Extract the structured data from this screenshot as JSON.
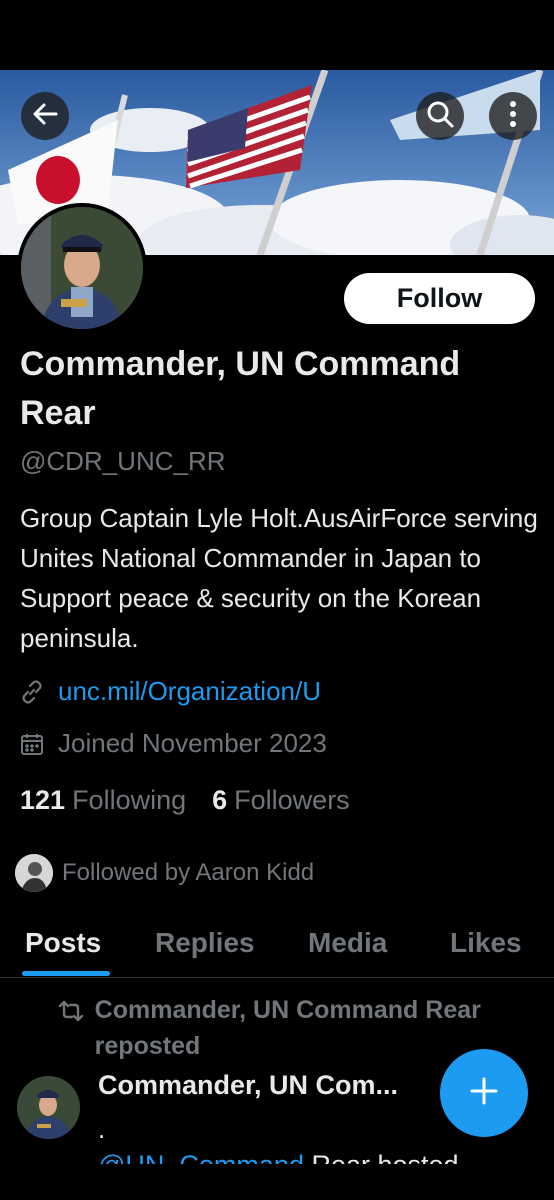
{
  "profile": {
    "name": "Commander, UN Command Rear",
    "handle": "@CDR_UNC_RR",
    "bio": "Group Captain Lyle Holt.AusAirForce serving Unites National Commander in Japan to Support peace & security on the Korean peninsula.",
    "link": "unc.mil/Organization/U",
    "joined": "Joined November 2023",
    "following_count": "121",
    "following_label": "Following",
    "followers_count": "6",
    "followers_label": "Followers",
    "followed_by": "Followed by Aaron Kidd"
  },
  "actions": {
    "follow_label": "Follow",
    "back_icon": "arrow-left-icon",
    "search_icon": "search-icon",
    "more_icon": "more-vertical-icon",
    "compose_icon": "plus-icon"
  },
  "tabs": [
    {
      "label": "Posts",
      "active": true
    },
    {
      "label": "Replies",
      "active": false
    },
    {
      "label": "Media",
      "active": false
    },
    {
      "label": "Likes",
      "active": false
    }
  ],
  "post": {
    "repost_label": "Commander, UN Command Rear reposted",
    "author": "Commander, UN Com...",
    "dot": ".",
    "text_mention": "@UN_Command",
    "text_rest": " Rear hosted"
  },
  "colors": {
    "accent": "#1d9bf0",
    "background": "#000000",
    "text_primary": "#e7e9ea",
    "text_secondary": "#71767b"
  }
}
